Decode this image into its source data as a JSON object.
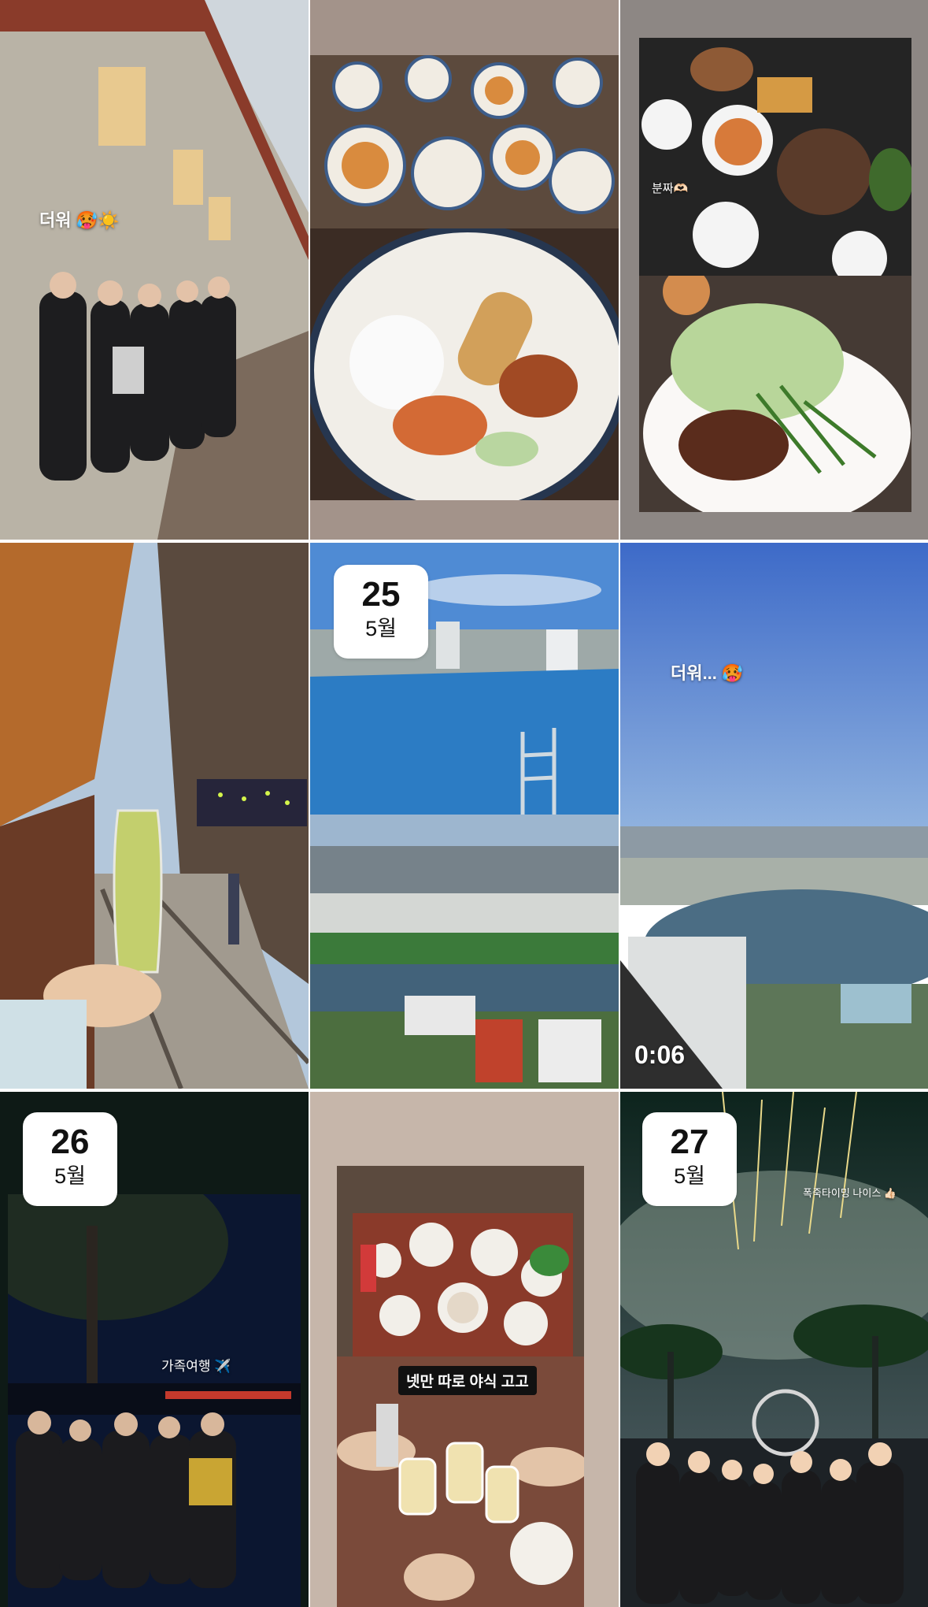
{
  "grid": {
    "tiles": [
      {
        "caption": "더워 🥵☀️"
      },
      {},
      {
        "caption": "분짜🫶🏻"
      },
      {},
      {
        "date_day": "25",
        "date_month": "5월"
      },
      {
        "caption": "더워... 🥵",
        "duration": "0:06"
      },
      {
        "date_day": "26",
        "date_month": "5월",
        "caption": "가족여행 ✈️"
      },
      {
        "caption": "넷만 따로 야식 고고"
      },
      {
        "date_day": "27",
        "date_month": "5월",
        "caption": "폭죽타이밍 나이스 👍🏻"
      }
    ]
  },
  "colors": {
    "background": "#ffffff",
    "badge_bg": "#ffffff",
    "badge_text": "#111111"
  }
}
